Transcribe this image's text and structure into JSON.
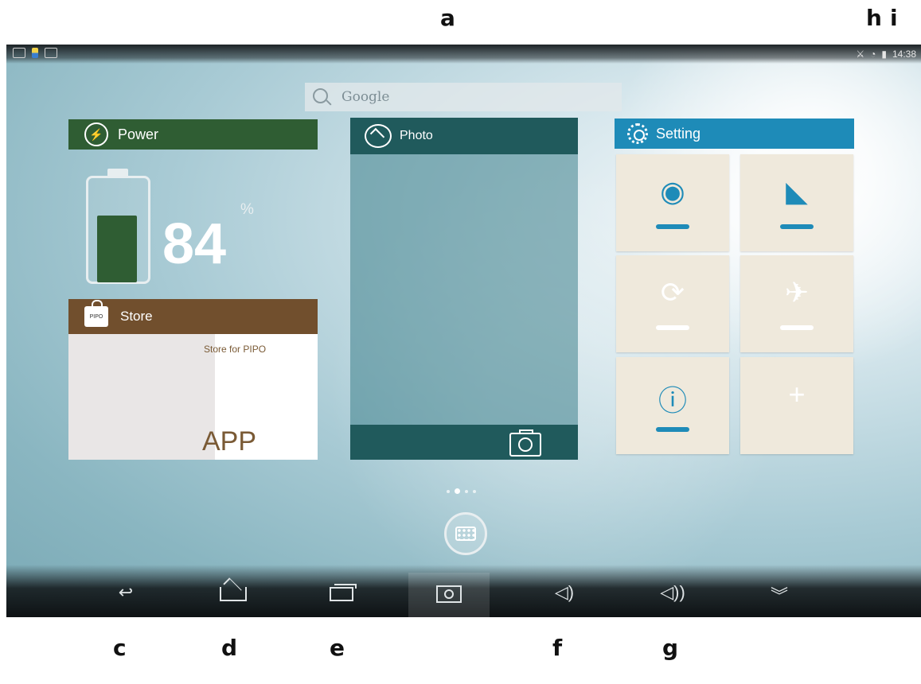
{
  "callouts": {
    "a": "a",
    "h": "h",
    "i": "i",
    "c": "c",
    "d": "d",
    "e": "e",
    "f": "f",
    "g": "g"
  },
  "status_bar": {
    "left_icons": [
      "screenshot-icon",
      "app-notification-icon",
      "photo-icon"
    ],
    "right_icons": [
      "usb-debug-icon",
      "wifi-icon",
      "battery-icon"
    ],
    "time": "14:38"
  },
  "search": {
    "label": "Google",
    "icon": "search-icon"
  },
  "power": {
    "title": "Power",
    "icon": "power-bolt-icon",
    "battery_value": "84",
    "battery_unit": "%",
    "battery_level": 0.84,
    "accent": "#2f5d33"
  },
  "store": {
    "title": "Store",
    "bag_text": "PIPO",
    "subtitle": "Store for PIPO",
    "app_label": "APP",
    "accent": "#714f2d"
  },
  "photo": {
    "title": "Photo",
    "icon": "image-icon",
    "footer_icon": "camera-icon",
    "accent": "#205a5c"
  },
  "setting": {
    "title": "Setting",
    "icon": "gear-icon",
    "accent": "#1e8bb8",
    "tiles": [
      {
        "name": "wifi-toggle",
        "icon": "wifi-icon",
        "glyph": "◉",
        "state": "on"
      },
      {
        "name": "sound-toggle",
        "icon": "mute-icon",
        "glyph": "◣",
        "state": "on"
      },
      {
        "name": "rotation-lock-toggle",
        "icon": "rotation-lock-icon",
        "glyph": "⟳",
        "state": "off"
      },
      {
        "name": "airplane-toggle",
        "icon": "airplane-icon",
        "glyph": "✈",
        "state": "off"
      },
      {
        "name": "info-tile",
        "icon": "info-icon",
        "glyph": "ⓘ",
        "state": "on"
      },
      {
        "name": "add-tile",
        "icon": "plus-icon",
        "glyph": "+",
        "state": "off"
      }
    ]
  },
  "page_indicator": {
    "count": 4,
    "current": 1
  },
  "navbar": {
    "buttons": [
      "back-button",
      "home-button",
      "recent-apps-button",
      "screenshot-button",
      "volume-down-button",
      "volume-up-button",
      "hide-bar-button"
    ],
    "glyphs": {
      "back": "↩",
      "vol_down": "◁)",
      "vol_up": "◁))",
      "hide": "︾"
    }
  }
}
